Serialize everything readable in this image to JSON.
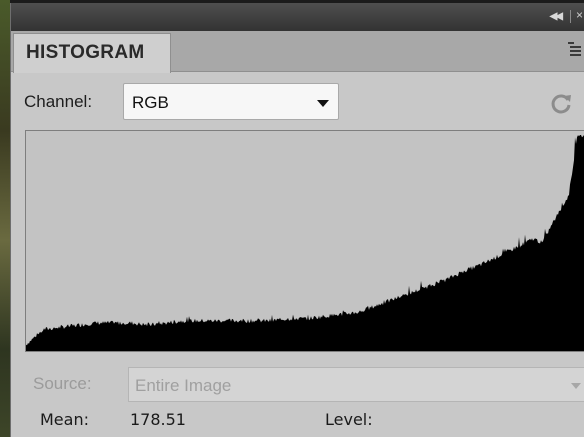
{
  "panel": {
    "tab_label": "HISTOGRAM",
    "titlebar_icons": [
      "collapse-icon",
      "close-icon"
    ],
    "menu_icon": "panel-menu-icon"
  },
  "channel": {
    "label": "Channel:",
    "selected": "RGB",
    "refresh_icon": "refresh-icon"
  },
  "source": {
    "label": "Source:",
    "selected": "Entire Image",
    "disabled": true
  },
  "stats": {
    "mean_label": "Mean:",
    "mean_value": "178.51",
    "level_label": "Level:",
    "level_value": ""
  },
  "chart_data": {
    "type": "area",
    "title": "",
    "xlabel": "",
    "ylabel": "",
    "xlim": [
      0,
      255
    ],
    "ylim": [
      0,
      1
    ],
    "grid": false,
    "x": [
      0,
      8,
      16,
      24,
      32,
      40,
      48,
      56,
      64,
      72,
      80,
      88,
      96,
      104,
      112,
      120,
      128,
      136,
      144,
      152,
      160,
      168,
      176,
      184,
      192,
      200,
      208,
      216,
      224,
      232,
      236,
      240,
      244,
      248,
      252,
      255
    ],
    "values": [
      0.03,
      0.1,
      0.11,
      0.12,
      0.13,
      0.13,
      0.13,
      0.12,
      0.13,
      0.14,
      0.14,
      0.14,
      0.14,
      0.14,
      0.14,
      0.15,
      0.15,
      0.16,
      0.17,
      0.18,
      0.21,
      0.24,
      0.27,
      0.3,
      0.33,
      0.37,
      0.4,
      0.44,
      0.48,
      0.52,
      0.5,
      0.58,
      0.65,
      0.72,
      1.0,
      1.0
    ],
    "colors": {
      "fill": "#000000",
      "background": "#c3c3c3"
    }
  }
}
